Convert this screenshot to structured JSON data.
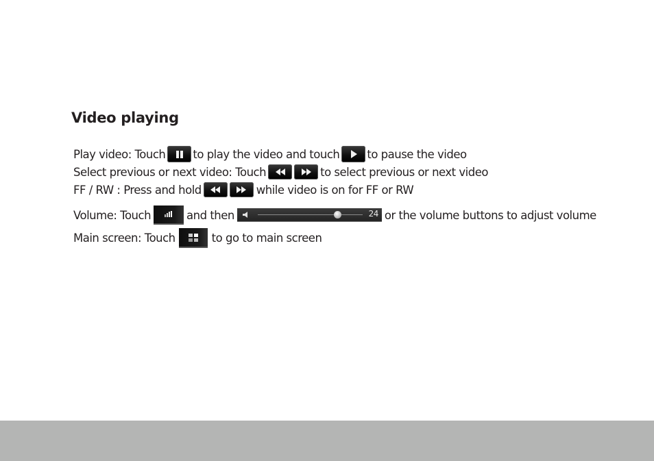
{
  "section": {
    "title": "Video playing"
  },
  "instructions": {
    "play": {
      "prefix": "Play video: Touch",
      "middle": "to play the video and touch",
      "suffix": "to pause the video",
      "icons": [
        "pause-icon",
        "play-icon"
      ]
    },
    "select": {
      "prefix": "Select previous or next video: Touch",
      "suffix": "to select previous or next video",
      "icons": [
        "rewind-icon",
        "fast-forward-icon"
      ]
    },
    "ffrw": {
      "prefix": "FF / RW : Press and hold",
      "suffix": "while video is on for FF or RW",
      "icons": [
        "rewind-icon",
        "fast-forward-icon"
      ]
    },
    "volume": {
      "prefix": "Volume: Touch",
      "middle": "and then",
      "suffix": "or the volume buttons to adjust volume",
      "icons": [
        "volume-icon",
        "volume-slider"
      ],
      "slider_value": "24",
      "slider_fraction": 0.76
    },
    "main": {
      "prefix": "Main screen: Touch",
      "suffix": "to go to main screen",
      "icons": [
        "home-grid-icon"
      ]
    }
  },
  "colors": {
    "text": "#231f20",
    "footer_band": "#b4b5b4",
    "button_bg": "#111111"
  }
}
